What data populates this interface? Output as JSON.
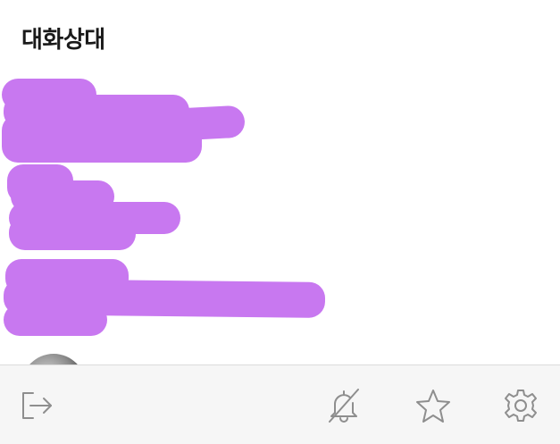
{
  "header": {
    "title": "대화상대"
  },
  "colors": {
    "redaction": "#c878f0",
    "icon": "#8e8e8e",
    "footer_bg": "#f6f6f6"
  },
  "contacts": [
    {
      "redacted": true
    },
    {
      "redacted": true
    },
    {
      "redacted": true
    },
    {
      "redacted": true
    }
  ],
  "footer": {
    "icons": [
      "logout-icon",
      "bell-off-icon",
      "star-icon",
      "gear-icon"
    ]
  }
}
